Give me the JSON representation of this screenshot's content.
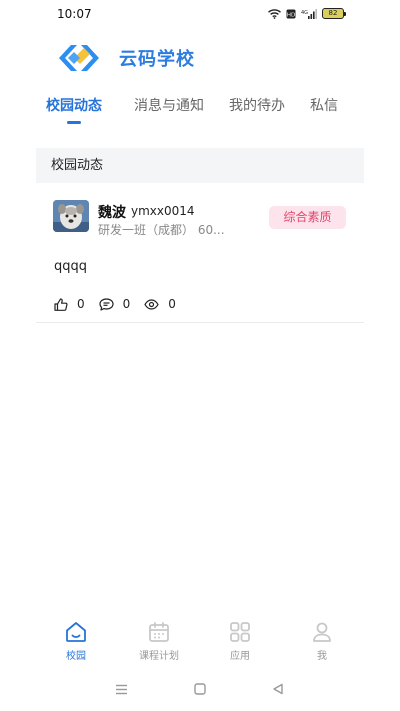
{
  "status_bar": {
    "time": "10:07",
    "battery": "82"
  },
  "header": {
    "title": "云码学校",
    "logo_colors": [
      "#2d8ef0",
      "#f5c23a"
    ]
  },
  "tabs": [
    {
      "label": "校园动态",
      "active": true
    },
    {
      "label": "消息与通知",
      "active": false
    },
    {
      "label": "我的待办",
      "active": false
    },
    {
      "label": "私信",
      "active": false
    }
  ],
  "section": {
    "title": "校园动态"
  },
  "post": {
    "author_name": "魏波",
    "author_id": "ymxx0014",
    "author_meta": "研发一班（成都）    60...",
    "tag": "综合素质",
    "content": "qqqq",
    "likes": "0",
    "comments": "0",
    "views": "0"
  },
  "bottom_nav": [
    {
      "label": "校园",
      "icon": "home-icon",
      "active": true
    },
    {
      "label": "课程计划",
      "icon": "calendar-icon",
      "active": false
    },
    {
      "label": "应用",
      "icon": "apps-grid-icon",
      "active": false
    },
    {
      "label": "我",
      "icon": "user-icon",
      "active": false
    }
  ],
  "colors": {
    "accent": "#2673d9",
    "tag_bg": "#fde4ec",
    "tag_text": "#e0466d"
  }
}
